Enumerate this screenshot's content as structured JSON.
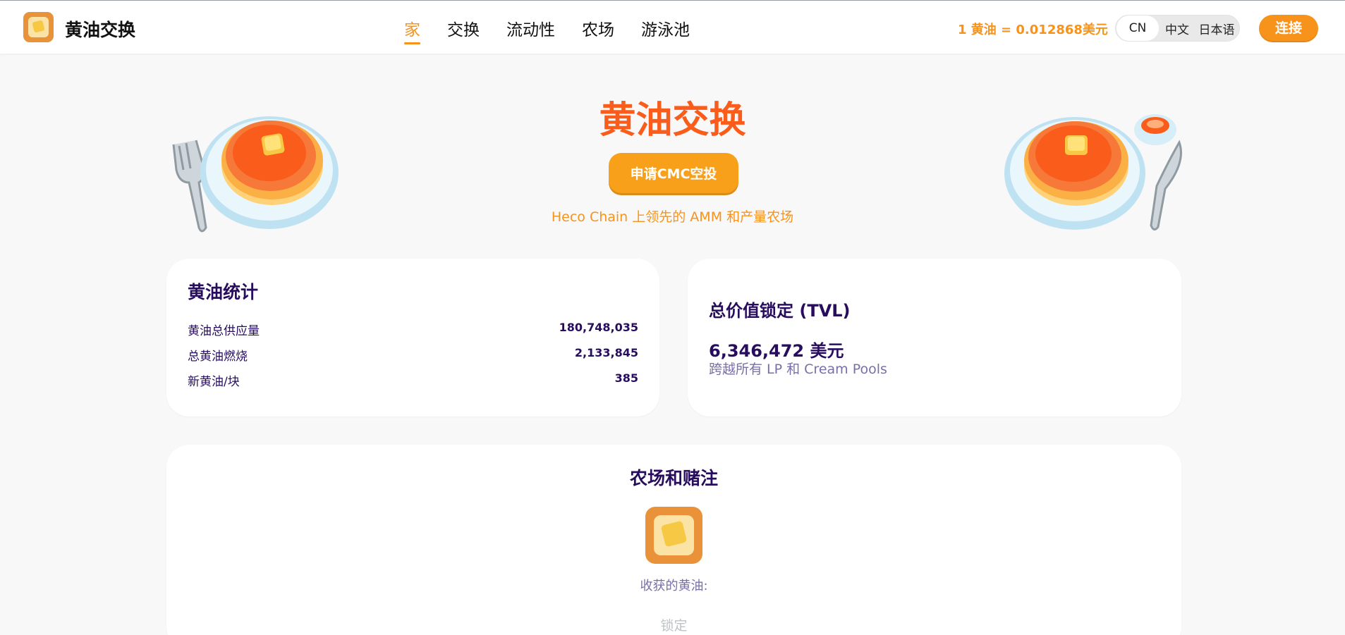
{
  "nav": {
    "brand": "黄油交换",
    "items": [
      {
        "label": "家",
        "active": true
      },
      {
        "label": "交换",
        "active": false
      },
      {
        "label": "流动性",
        "active": false
      },
      {
        "label": "农场",
        "active": false
      },
      {
        "label": "游泳池",
        "active": false
      }
    ],
    "price": "1 黄油 = 0.012868美元",
    "languages": [
      "CN",
      "中文",
      "日本语"
    ],
    "selected_language": "CN",
    "connect_label": "连接"
  },
  "hero": {
    "title": "黄油交换",
    "cta_label": "申请CMC空投",
    "tagline": "Heco Chain 上领先的 AMM 和产量农场"
  },
  "stats": {
    "title": "黄油统计",
    "rows": [
      {
        "label": "黄油总供应量",
        "value": "180,748,035"
      },
      {
        "label": "总黄油燃烧",
        "value": "2,133,845"
      },
      {
        "label": "新黄油/块",
        "value": "385"
      }
    ]
  },
  "tvl": {
    "title": "总价值锁定 (TVL)",
    "amount": "6,346,472 美元",
    "subtitle": "跨越所有 LP 和 Cream Pools"
  },
  "farms": {
    "title": "农场和赌注",
    "harvest_label": "收获的黄油:",
    "locked_label": "锁定"
  },
  "colors": {
    "accent": "#f7931a",
    "title_orange": "#fa5c1b",
    "text_purple": "#280d5f",
    "muted_purple": "#7a6eaa",
    "background": "#f8f8f8"
  },
  "icons": [
    "butter-toast-logo-icon",
    "pancake-fork-illustration",
    "pancake-knife-syrup-illustration",
    "butter-toast-farm-icon"
  ]
}
